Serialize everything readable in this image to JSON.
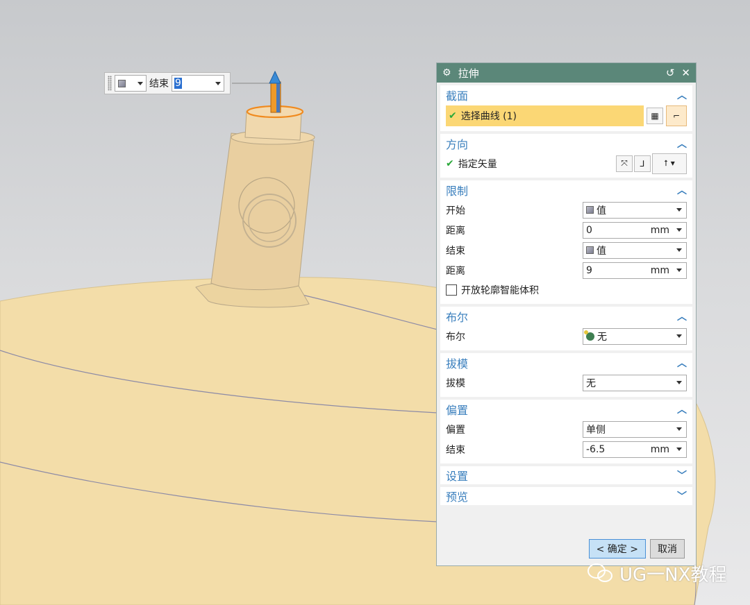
{
  "mini_toolbar": {
    "label": "结束",
    "value": "9"
  },
  "dialog": {
    "title": "拉伸",
    "sections": {
      "section": {
        "title": "截面",
        "select_curve": "选择曲线 (1)"
      },
      "direction": {
        "title": "方向",
        "specify_vector": "指定矢量"
      },
      "limits": {
        "title": "限制",
        "start_label": "开始",
        "start_value": "值",
        "dist1_label": "距离",
        "dist1_value": "0",
        "dist1_unit": "mm",
        "end_label": "结束",
        "end_value": "值",
        "dist2_label": "距离",
        "dist2_value": "9",
        "dist2_unit": "mm",
        "open_profile": "开放轮廓智能体积"
      },
      "boolean": {
        "title": "布尔",
        "label": "布尔",
        "value": "无"
      },
      "draft": {
        "title": "拔模",
        "label": "拔模",
        "value": "无"
      },
      "offset": {
        "title": "偏置",
        "label": "偏置",
        "value": "单侧",
        "end_label": "结束",
        "end_value": "-6.5",
        "end_unit": "mm"
      },
      "settings": {
        "title": "设置"
      },
      "preview": {
        "title": "预览"
      }
    },
    "ok": "< 确定 >",
    "cancel": "取消"
  },
  "watermark": "UG一NX教程",
  "colors": {
    "titlebar": "#5b8779",
    "section_title": "#3a7fbd",
    "selection_highlight": "#fbd775",
    "model": "#f4deab"
  }
}
